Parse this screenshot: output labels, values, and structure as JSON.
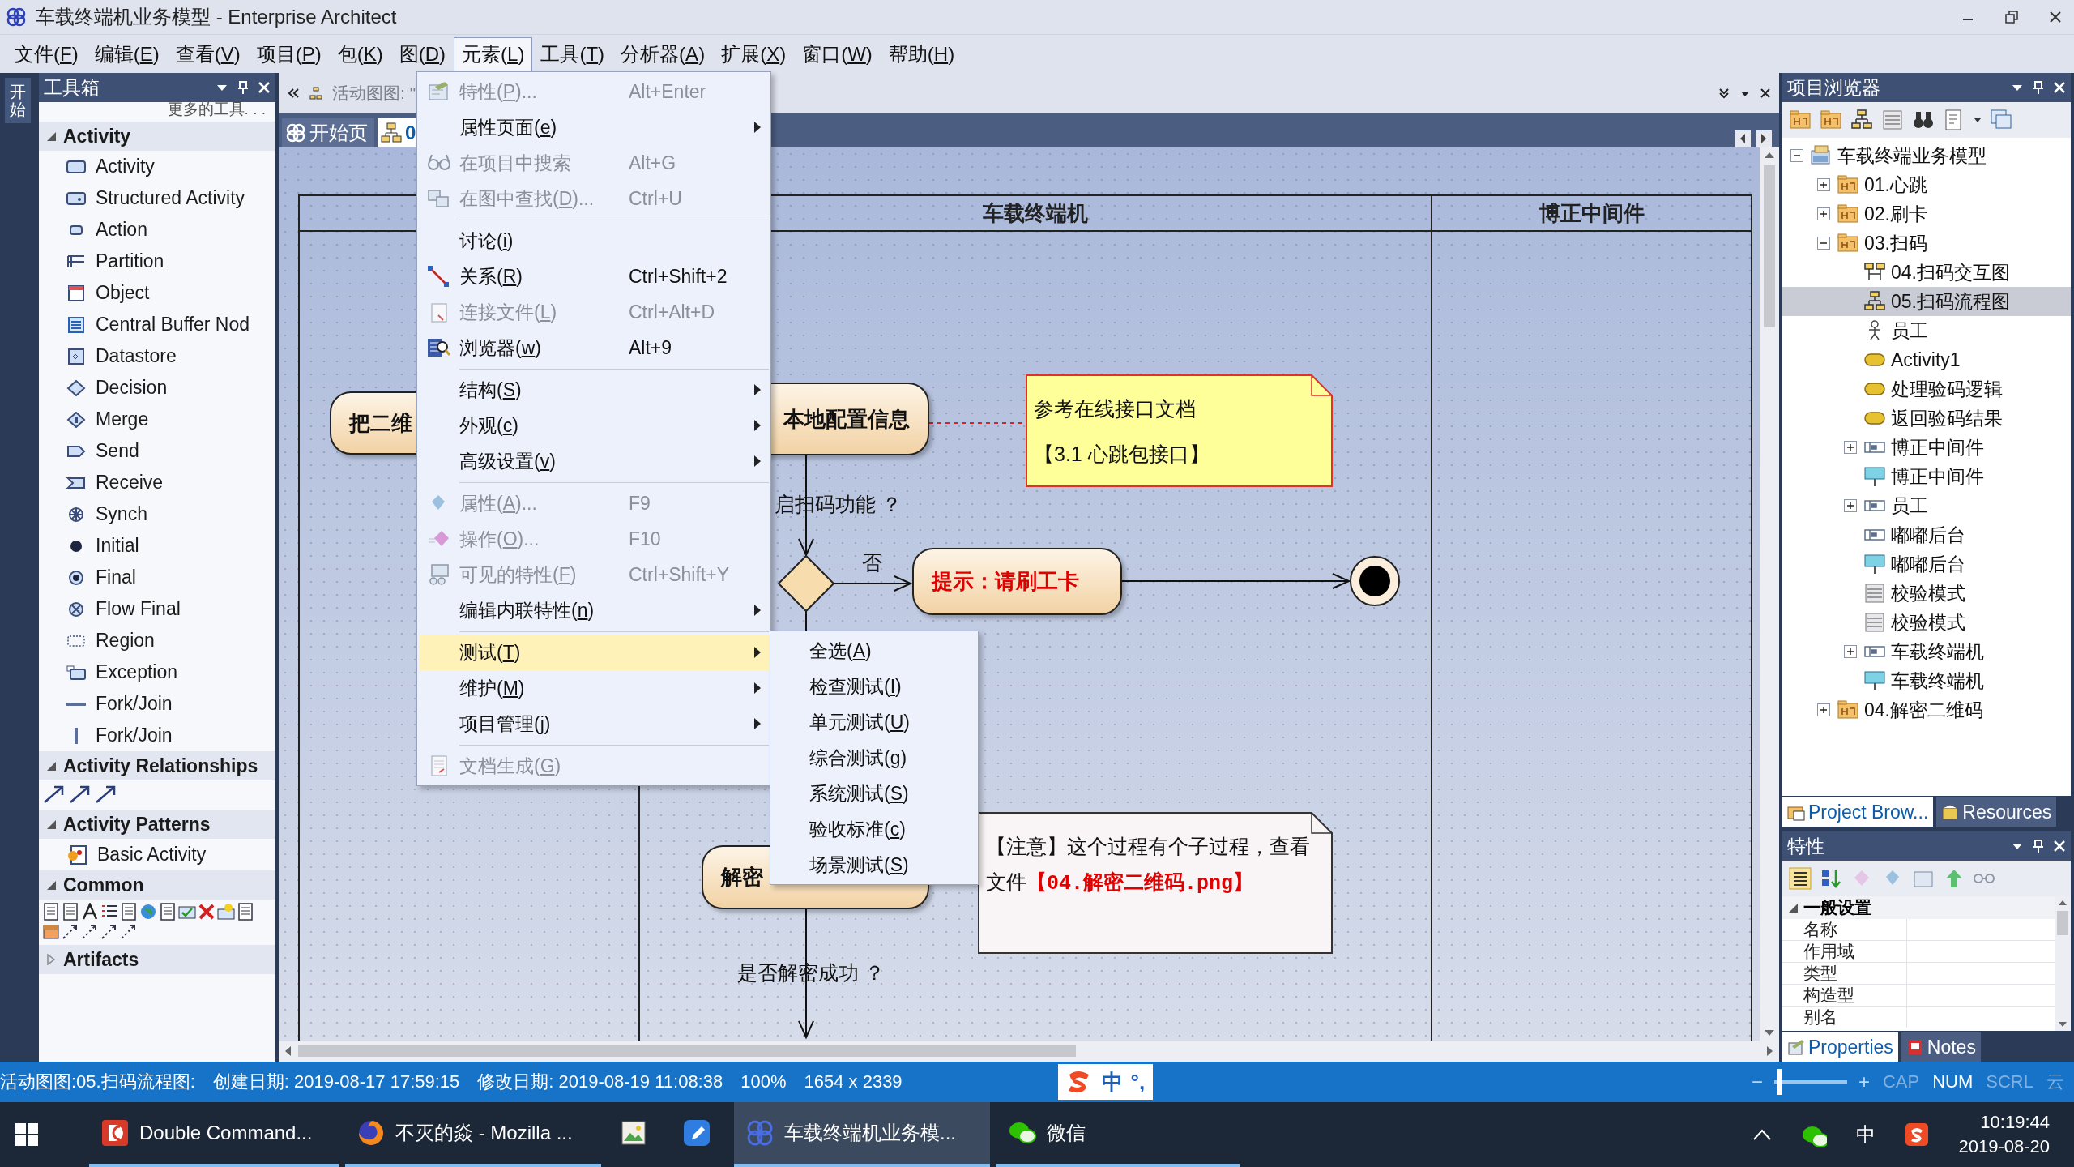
{
  "window": {
    "title": "车载终端机业务模型 - Enterprise Architect"
  },
  "menubar": [
    {
      "label": "文件(F)",
      "selected": false
    },
    {
      "label": "编辑(E)",
      "selected": false
    },
    {
      "label": "查看(V)",
      "selected": false
    },
    {
      "label": "项目(P)",
      "selected": false
    },
    {
      "label": "包(K)",
      "selected": false
    },
    {
      "label": "图(D)",
      "selected": false
    },
    {
      "label": "元素(L)",
      "selected": true
    },
    {
      "label": "工具(T)",
      "selected": false
    },
    {
      "label": "分析器(A)",
      "selected": false
    },
    {
      "label": "扩展(X)",
      "selected": false
    },
    {
      "label": "窗口(W)",
      "selected": false
    },
    {
      "label": "帮助(H)",
      "selected": false
    }
  ],
  "side_strip": {
    "label": "开始"
  },
  "toolbox": {
    "title": "工具箱",
    "more": "更多的工具. . .",
    "sections": [
      {
        "title": "Activity",
        "kind": "list",
        "expanded": true,
        "items": [
          "Activity",
          "Structured Activity",
          "Action",
          "Partition",
          "Object",
          "Central Buffer Nod",
          "Datastore",
          "Decision",
          "Merge",
          "Send",
          "Receive",
          "Synch",
          "Initial",
          "Final",
          "Flow Final",
          "Region",
          "Exception",
          "Fork/Join",
          "Fork/Join"
        ]
      },
      {
        "title": "Activity Relationships",
        "kind": "icons",
        "expanded": true
      },
      {
        "title": "Activity Patterns",
        "kind": "list",
        "expanded": true,
        "items": [
          "Basic Activity"
        ]
      },
      {
        "title": "Common",
        "kind": "icons",
        "expanded": true
      },
      {
        "title": "Artifacts",
        "kind": "list",
        "expanded": false
      }
    ]
  },
  "diagram": {
    "header": "活动图图: \"",
    "tabs": [
      {
        "label": "开始页",
        "selected": false
      },
      {
        "label": "0",
        "selected": true
      }
    ],
    "lanes": [
      {
        "title": "车载终端机"
      },
      {
        "title": "博正中间件"
      }
    ],
    "nodes": [
      {
        "kind": "action",
        "text": "把二维"
      },
      {
        "kind": "action",
        "text": "本地配置信息"
      },
      {
        "kind": "decision"
      },
      {
        "kind": "action",
        "text": "提示：请刷工卡",
        "color": "#e00000"
      },
      {
        "kind": "final"
      },
      {
        "kind": "action",
        "text": "解密"
      }
    ],
    "notes": [
      {
        "lines": [
          "参考在线接口文档",
          "【3.1 心跳包接口】"
        ]
      },
      {
        "text": "【注意】这个过程有个子过程，查看文件**【04.解密二维码.png】**"
      }
    ],
    "guards": [
      "启扫码功能 ？",
      "否",
      "是否解密成功 ？"
    ]
  },
  "element_menu": {
    "items": [
      {
        "kind": "item",
        "label": "特性(P)...",
        "shortcut": "Alt+Enter",
        "disabled": true,
        "submenu": false,
        "selected": false
      },
      {
        "kind": "item",
        "label": "属性页面(e)",
        "disabled": false,
        "submenu": true,
        "selected": false
      },
      {
        "kind": "item",
        "label": "在项目中搜索",
        "shortcut": "Alt+G",
        "disabled": true,
        "submenu": false,
        "selected": false
      },
      {
        "kind": "item",
        "label": "在图中查找(D)...",
        "shortcut": "Ctrl+U",
        "disabled": true,
        "submenu": false,
        "selected": false
      },
      {
        "kind": "separator"
      },
      {
        "kind": "item",
        "label": "讨论(i)",
        "disabled": false,
        "submenu": false,
        "selected": false
      },
      {
        "kind": "item",
        "label": "关系(R)",
        "shortcut": "Ctrl+Shift+2",
        "disabled": false,
        "submenu": false,
        "selected": false
      },
      {
        "kind": "item",
        "label": "连接文件(L)",
        "shortcut": "Ctrl+Alt+D",
        "disabled": true,
        "submenu": false,
        "selected": false
      },
      {
        "kind": "item",
        "label": "浏览器(w)",
        "shortcut": "Alt+9",
        "disabled": false,
        "submenu": false,
        "selected": false
      },
      {
        "kind": "separator"
      },
      {
        "kind": "item",
        "label": "结构(S)",
        "disabled": false,
        "submenu": true,
        "selected": false
      },
      {
        "kind": "item",
        "label": "外观(c)",
        "disabled": false,
        "submenu": true,
        "selected": false
      },
      {
        "kind": "item",
        "label": "高级设置(v)",
        "disabled": false,
        "submenu": true,
        "selected": false
      },
      {
        "kind": "separator"
      },
      {
        "kind": "item",
        "label": "属性(A)...",
        "shortcut": "F9",
        "disabled": true,
        "submenu": false,
        "selected": false
      },
      {
        "kind": "item",
        "label": "操作(O)...",
        "shortcut": "F10",
        "disabled": true,
        "submenu": false,
        "selected": false
      },
      {
        "kind": "item",
        "label": "可见的特性(F)",
        "shortcut": "Ctrl+Shift+Y",
        "disabled": true,
        "submenu": false,
        "selected": false
      },
      {
        "kind": "item",
        "label": "编辑内联特性(n)",
        "disabled": false,
        "submenu": true,
        "selected": false
      },
      {
        "kind": "separator"
      },
      {
        "kind": "item",
        "label": "测试(T)",
        "disabled": false,
        "submenu": true,
        "selected": true
      },
      {
        "kind": "item",
        "label": "维护(M)",
        "disabled": false,
        "submenu": true,
        "selected": false
      },
      {
        "kind": "item",
        "label": "项目管理(j)",
        "disabled": false,
        "submenu": true,
        "selected": false
      },
      {
        "kind": "separator"
      },
      {
        "kind": "item",
        "label": "文档生成(G)",
        "disabled": true,
        "submenu": false,
        "selected": false
      }
    ]
  },
  "test_submenu": {
    "items": [
      "全选(A)",
      "检查测试(I)",
      "单元测试(U)",
      "综合测试(g)",
      "系统测试(S)",
      "验收标准(c)",
      "场景测试(S)"
    ]
  },
  "project_browser": {
    "title": "项目浏览器",
    "tree": [
      {
        "label": "车载终端业务模型",
        "kind": "model",
        "expanded": true,
        "selected": false,
        "children": [
          {
            "label": "01.心跳",
            "kind": "package",
            "expanded": false,
            "selected": false
          },
          {
            "label": "02.刷卡",
            "kind": "package",
            "expanded": false,
            "selected": false
          },
          {
            "label": "03.扫码",
            "kind": "package",
            "expanded": true,
            "selected": false,
            "children": [
              {
                "label": "04.扫码交互图",
                "kind": "sequence",
                "selected": false
              },
              {
                "label": "05.扫码流程图",
                "kind": "flowchart",
                "selected": true
              },
              {
                "label": "员工",
                "kind": "actor",
                "selected": false
              },
              {
                "label": "Activity1",
                "kind": "activity",
                "selected": false
              },
              {
                "label": "处理验码逻辑",
                "kind": "activity",
                "selected": false
              },
              {
                "label": "返回验码结果",
                "kind": "activity",
                "selected": false
              },
              {
                "label": "博正中间件",
                "kind": "partition",
                "expanded": false,
                "selected": false
              },
              {
                "label": "博正中间件",
                "kind": "instance",
                "selected": false
              },
              {
                "label": "员工",
                "kind": "partition",
                "expanded": false,
                "selected": false
              },
              {
                "label": "嘟嘟后台",
                "kind": "partition",
                "selected": false
              },
              {
                "label": "嘟嘟后台",
                "kind": "instance",
                "selected": false
              },
              {
                "label": "校验模式",
                "kind": "classifier",
                "selected": false
              },
              {
                "label": "校验模式",
                "kind": "classifier",
                "selected": false
              },
              {
                "label": "车载终端机",
                "kind": "partition",
                "expanded": false,
                "selected": false
              },
              {
                "label": "车载终端机",
                "kind": "instance",
                "selected": false
              }
            ]
          },
          {
            "label": "04.解密二维码",
            "kind": "package",
            "expanded": false,
            "selected": false
          }
        ]
      }
    ],
    "tabs": [
      {
        "label": "Project Brow...",
        "selected": true
      },
      {
        "label": "Resources",
        "selected": false
      }
    ]
  },
  "properties": {
    "title": "特性",
    "group": "一般设置",
    "rows": [
      "名称",
      "作用域",
      "类型",
      "构造型",
      "别名"
    ],
    "tabs": [
      {
        "label": "Properties",
        "selected": true
      },
      {
        "label": "Notes",
        "selected": false
      }
    ]
  },
  "status_bar": {
    "texts": [
      "活动图图:05.扫码流程图:",
      "创建日期: 2019-08-17 17:59:15",
      "修改日期: 2019-08-19 11:08:38",
      "100%",
      "1654 x 2339"
    ],
    "ime": [
      "中",
      "°,"
    ],
    "zoom_out": "−",
    "zoom_in": "+",
    "zoom": {
      "level": 0.03
    },
    "keys": [
      {
        "label": "CAP",
        "on": false
      },
      {
        "label": "NUM",
        "on": true
      },
      {
        "label": "SCRL",
        "on": false
      },
      {
        "label": "云",
        "on": false
      }
    ]
  },
  "taskbar": {
    "apps": [
      {
        "label": "Double Command...",
        "selected": false,
        "running": true
      },
      {
        "label": "不灭的焱 - Mozilla ...",
        "selected": false,
        "running": true
      },
      {
        "selected": false,
        "running": false
      },
      {
        "selected": false,
        "running": false
      },
      {
        "label": "车载终端机业务模...",
        "selected": true,
        "running": true
      },
      {
        "label": "微信",
        "selected": false,
        "running": true
      }
    ],
    "ime": "中",
    "time": "10:19:44",
    "date": "2019-08-20"
  }
}
